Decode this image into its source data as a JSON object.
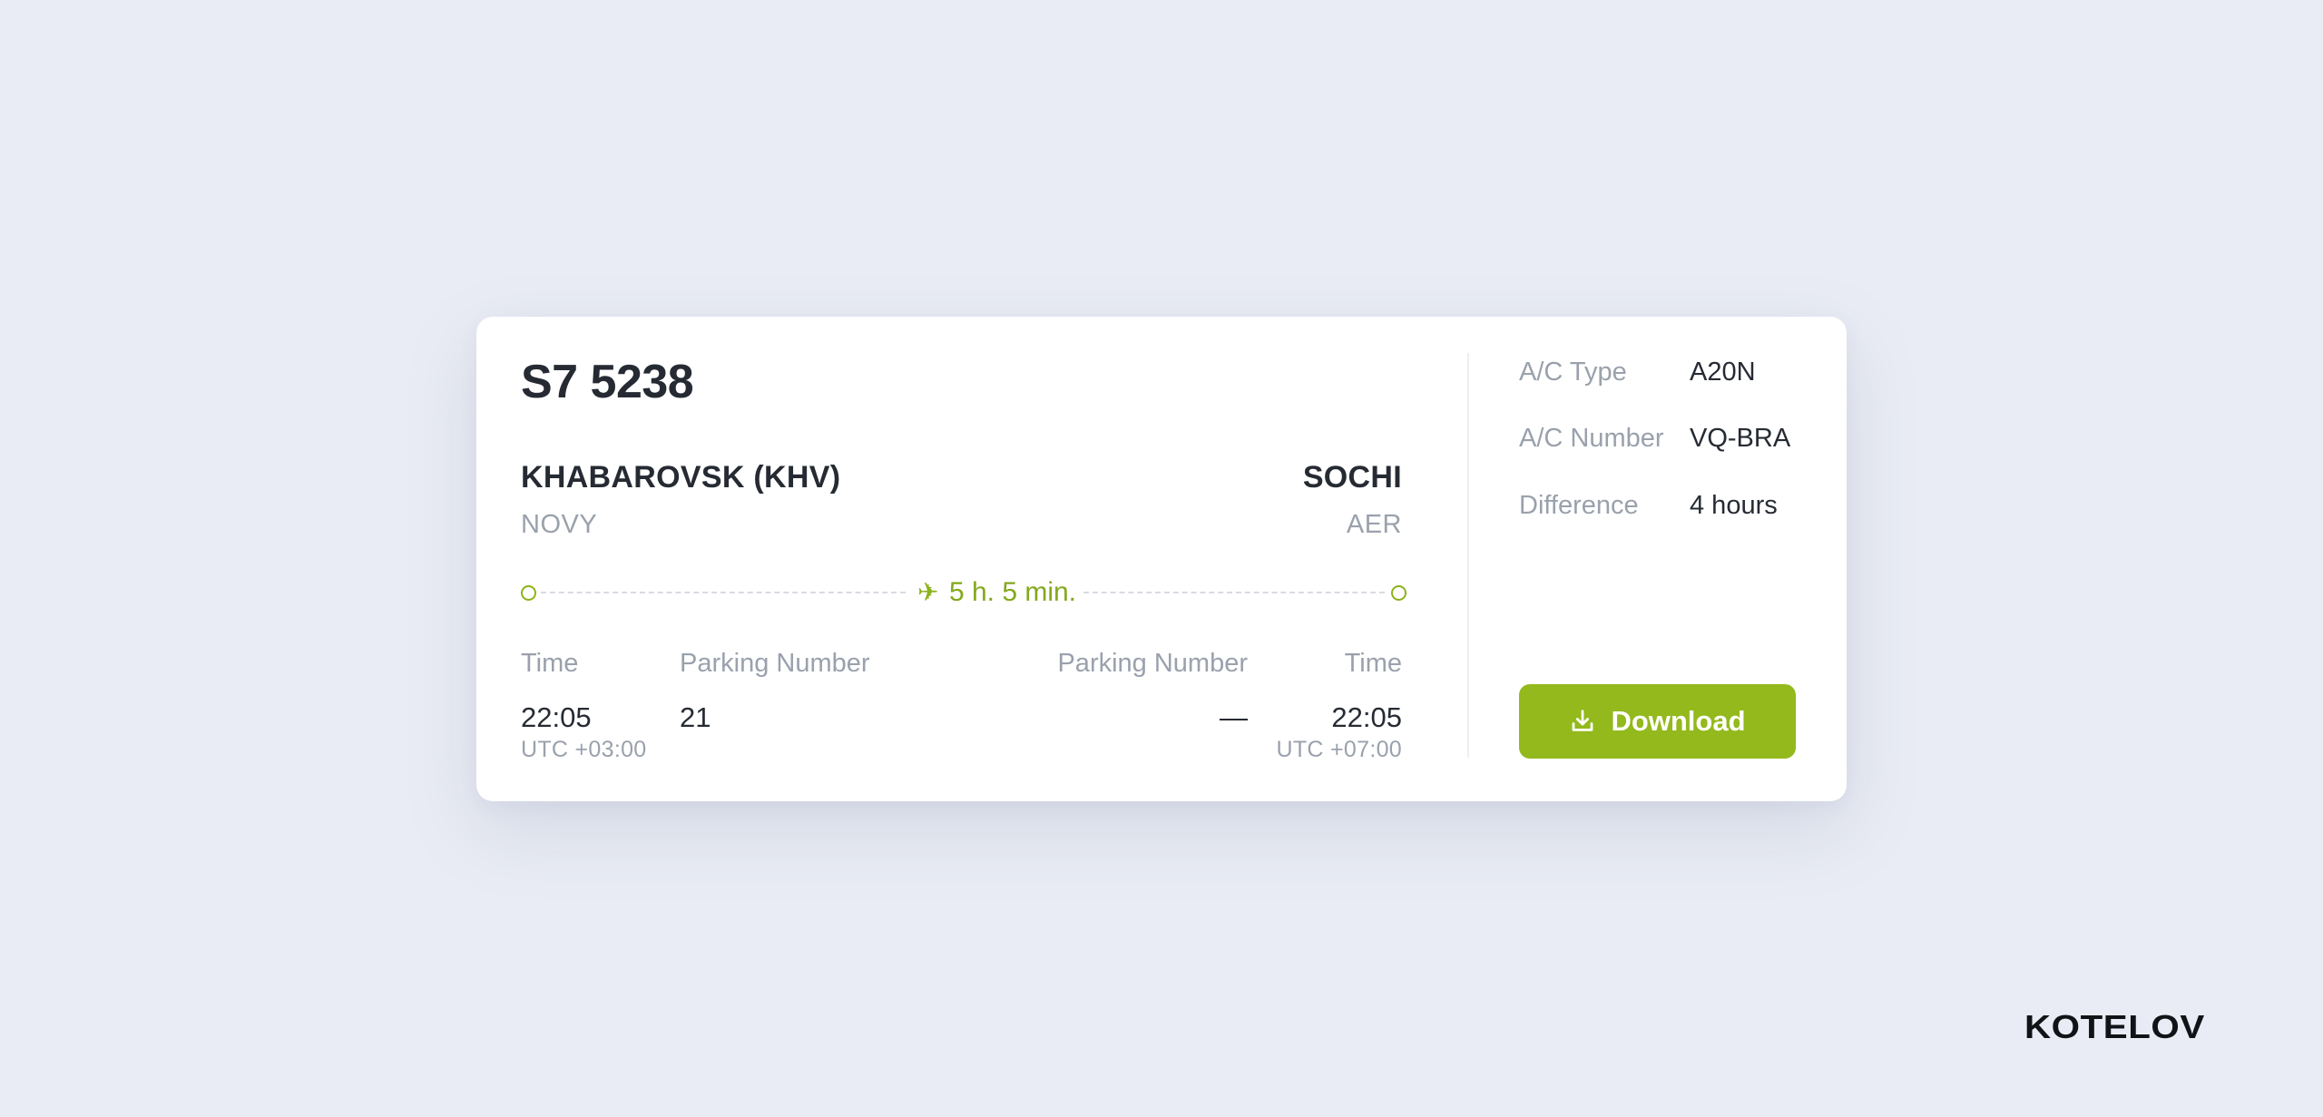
{
  "flight": {
    "number": "S7 5238",
    "departure": {
      "city": "KHABAROVSK (KHV)",
      "airport": "NOVY",
      "time_label": "Time",
      "parking_label": "Parking Number",
      "time": "22:05",
      "parking": "21",
      "timezone": "UTC +03:00"
    },
    "arrival": {
      "city": "SOCHI",
      "airport": "AER",
      "time_label": "Time",
      "parking_label": "Parking Number",
      "time": "22:05",
      "parking": "—",
      "timezone": "UTC +07:00"
    },
    "duration": "5 h. 5 min."
  },
  "aircraft": {
    "type_label": "A/C Type",
    "type_value": "A20N",
    "number_label": "A/C Number",
    "number_value": "VQ-BRA",
    "difference_label": "Difference",
    "difference_value": "4 hours"
  },
  "actions": {
    "download_label": "Download"
  },
  "brand": {
    "name": "KOTELOV"
  },
  "colors": {
    "accent": "#93b91c",
    "background": "#e9ecf4",
    "card": "#ffffff",
    "muted_text": "#9aa1ac",
    "text": "#262b33"
  },
  "icons": {
    "plane": "plane-icon",
    "download": "download-icon"
  }
}
